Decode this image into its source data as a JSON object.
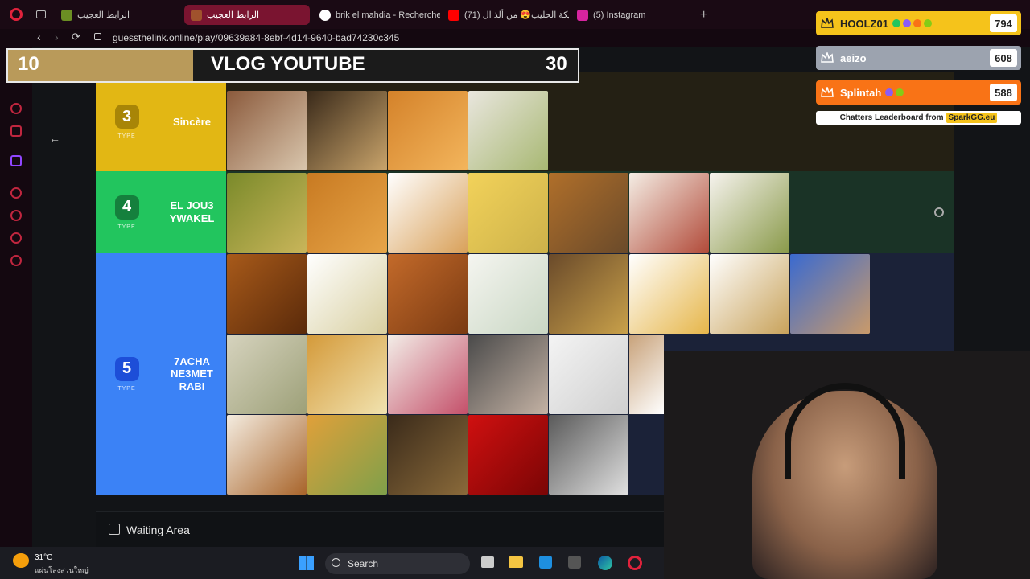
{
  "browser": {
    "tabs": [
      {
        "label": "الرابط العجيب",
        "active": false
      },
      {
        "label": "الرابط العجيب",
        "active": true
      },
      {
        "label": "brik el mahdia - Recherche",
        "active": false
      },
      {
        "label": "(71) بريكة الحليب😍 من ألذ ال",
        "active": false
      },
      {
        "label": "(5) Instagram",
        "active": false
      }
    ],
    "url": "guessthelink.online/play/09639a84-8ebf-4d14-9640-bad74230c345"
  },
  "timer": {
    "left_value": "10",
    "title": "VLOG YOUTUBE",
    "right_value": "30",
    "progress": 0.32
  },
  "tiers": [
    {
      "rank": "3",
      "type_label": "TYPE",
      "name": "Sincère",
      "color": "#e2b714",
      "badge_color": "#a88507",
      "image_count": 4
    },
    {
      "rank": "4",
      "type_label": "TYPE",
      "name": "EL JOU3 YWAKEL",
      "color": "#22c55e",
      "badge_color": "#15803d",
      "image_count": 7
    },
    {
      "rank": "5",
      "type_label": "TYPE",
      "name": "7ACHA NE3MET RABI",
      "color": "#3b82f6",
      "badge_color": "#1d4ed8",
      "image_count": 24
    }
  ],
  "leaderboard": {
    "entries": [
      {
        "name": "HOOLZ01",
        "score": "794",
        "color": "#f5c31b"
      },
      {
        "name": "aeizo",
        "score": "608",
        "color": "#9ca3af"
      },
      {
        "name": "Splintah",
        "score": "588",
        "color": "#f97316"
      }
    ],
    "footer_text": "Chatters Leaderboard from",
    "footer_brand": "SparkGG.eu"
  },
  "waiting_area": {
    "label": "Waiting Area"
  },
  "taskbar": {
    "temperature": "31°C",
    "weather_desc": "แผ่นโล่งส่วนใหญ่",
    "search_label": "Search"
  }
}
